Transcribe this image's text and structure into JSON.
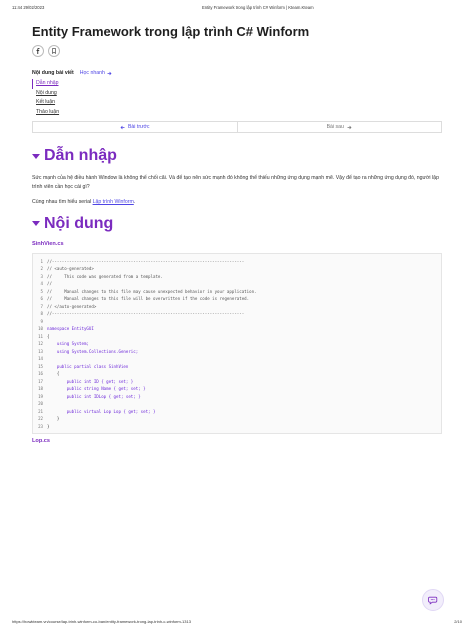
{
  "print_header": {
    "datetime": "11:44 29/02/2023",
    "page_title": "Entity Framework trong lập trình C# Winform | Kteam.Kteam"
  },
  "article": {
    "title": "Entity Framework trong lập trình C# Winform",
    "share_icons": [
      "facebook-icon",
      "bookmark-icon"
    ]
  },
  "toc": {
    "title": "Nội dung bài viết",
    "quick_label": "Học nhanh",
    "items": [
      "Dẫn nhập",
      "Nội dung",
      "Kết luận",
      "Thảo luận"
    ]
  },
  "pager": {
    "prev_label": "Bài trước",
    "next_label": "Bài sau"
  },
  "intro": {
    "heading": "Dẫn nhập",
    "paragraph1": "Sức mạnh của hệ điều hành Window là không thể chối cãi. Và để tạo nên sức mạnh đó không thể thiếu những ứng dụng mạnh mẽ. Vậy để tạo ra những ứng dụng đó, người lập trình viên cần học cái gì?",
    "paragraph2_prefix": "Cùng nhau tìm hiểu serial ",
    "paragraph2_link": "Lập trình Winform",
    "paragraph2_suffix": "."
  },
  "content": {
    "heading": "Nội dung",
    "file1": "SinhVien.cs",
    "file2": "Lop.cs",
    "code_lines": [
      {
        "n": "1",
        "t": "//------------------------------------------------------------------------------",
        "k": "cm"
      },
      {
        "n": "2",
        "t": "// <auto-generated>",
        "k": "cm"
      },
      {
        "n": "3",
        "t": "//     This code was generated from a template.",
        "k": "cm"
      },
      {
        "n": "4",
        "t": "//",
        "k": "cm"
      },
      {
        "n": "5",
        "t": "//     Manual changes to this file may cause unexpected behavior in your application.",
        "k": "cm"
      },
      {
        "n": "6",
        "t": "//     Manual changes to this file will be overwritten if the code is regenerated.",
        "k": "cm"
      },
      {
        "n": "7",
        "t": "// </auto-generated>",
        "k": "cm"
      },
      {
        "n": "8",
        "t": "//------------------------------------------------------------------------------",
        "k": "cm"
      },
      {
        "n": "9",
        "t": "",
        "k": ""
      },
      {
        "n": "10",
        "t": "namespace EntityGUI",
        "k": "kw"
      },
      {
        "n": "11",
        "t": "{",
        "k": ""
      },
      {
        "n": "12",
        "t": "    using System;",
        "k": "kw"
      },
      {
        "n": "13",
        "t": "    using System.Collections.Generic;",
        "k": "kw"
      },
      {
        "n": "14",
        "t": "",
        "k": ""
      },
      {
        "n": "15",
        "t": "    public partial class SinhVien",
        "k": "kw"
      },
      {
        "n": "16",
        "t": "    {",
        "k": ""
      },
      {
        "n": "17",
        "t": "        public int ID { get; set; }",
        "k": "kw"
      },
      {
        "n": "18",
        "t": "        public string Name { get; set; }",
        "k": "kw"
      },
      {
        "n": "19",
        "t": "        public int IDLop { get; set; }",
        "k": "kw"
      },
      {
        "n": "20",
        "t": "",
        "k": ""
      },
      {
        "n": "21",
        "t": "        public virtual Lop Lop { get; set; }",
        "k": "kw"
      },
      {
        "n": "22",
        "t": "    }",
        "k": ""
      },
      {
        "n": "23",
        "t": "}",
        "k": ""
      }
    ]
  },
  "print_footer": {
    "url": "https://howkteam.vn/course/lap-trinh-winform-co-ban/entity-framework-trong-lap-trinh-c-winform-1313",
    "page": "2/10"
  }
}
